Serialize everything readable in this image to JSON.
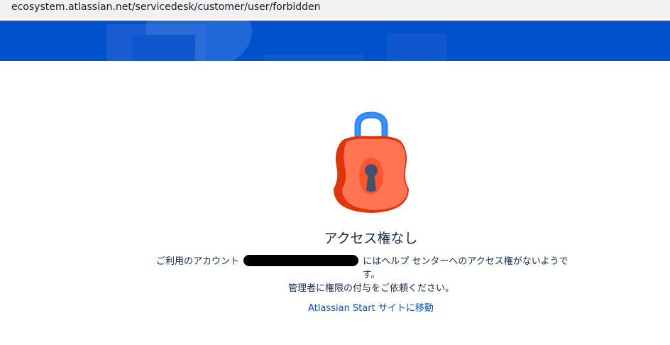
{
  "browser": {
    "url": "ecosystem.atlassian.net/servicedesk/customer/user/forbidden"
  },
  "colors": {
    "banner_blue": "#0052cc",
    "title_text": "#172b4d",
    "link": "#0052cc",
    "lock_body": "#ff5630",
    "lock_shackle": "#2684ff"
  },
  "icon": {
    "name": "lock-icon"
  },
  "error": {
    "title": "アクセス権なし",
    "message_part1": "ご利用のアカウント",
    "account_redacted": "(redacted email)",
    "message_part2": "にはヘルプ センターへのアクセス権がないようで",
    "message_part3": "す。",
    "message_line2": "管理者に権限の付与をご依頼ください。",
    "link_label": "Atlassian Start サイトに移動"
  }
}
